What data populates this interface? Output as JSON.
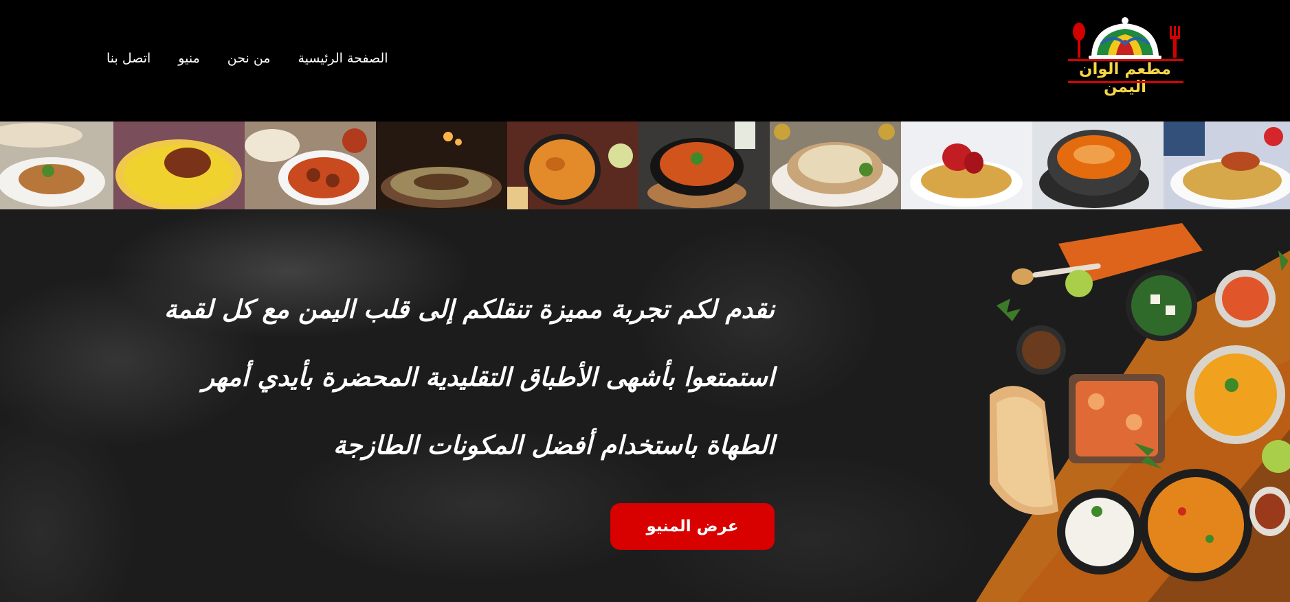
{
  "header": {
    "logo": {
      "name": "مطعم الوان اليمن",
      "icon": "serving-dome-icon"
    },
    "nav": [
      {
        "label": "الصفحة الرئيسية",
        "name": "nav-home"
      },
      {
        "label": "من نحن",
        "name": "nav-about"
      },
      {
        "label": "منيو",
        "name": "nav-menu"
      },
      {
        "label": "اتصل بنا",
        "name": "nav-contact"
      }
    ]
  },
  "strip": {
    "tiles": [
      "dish-photo-1",
      "dish-photo-2",
      "dish-photo-3",
      "dish-photo-4",
      "dish-photo-5",
      "dish-photo-6",
      "dish-photo-7",
      "dish-photo-8",
      "dish-photo-9",
      "dish-photo-10"
    ]
  },
  "hero": {
    "lines": [
      "نقدم لكم تجربة مميزة تنقلكم إلى قلب اليمن مع كل لقمة",
      "استمتعوا بأشهى الأطباق التقليدية المحضرة بأيدي أمهر",
      "الطهاة باستخدام أفضل المكونات الطازجة"
    ],
    "button_label": "عرض المنيو"
  },
  "colors": {
    "background": "#000000",
    "accent_red": "#d90000",
    "logo_yellow": "#f7d548",
    "hero_bg": "#1c1c1c"
  }
}
